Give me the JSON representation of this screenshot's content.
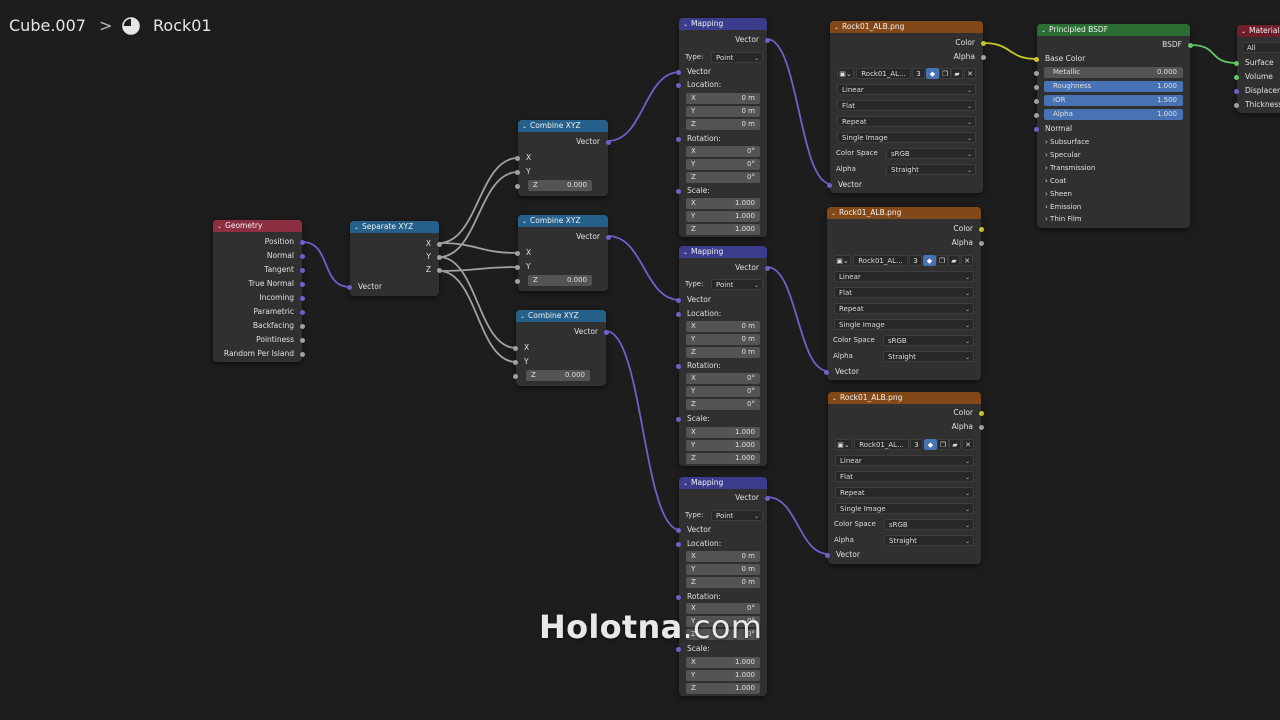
{
  "breadcrumb": {
    "object": "Cube.007",
    "separator": ">",
    "material": "Rock01"
  },
  "geometry": {
    "title": "Geometry",
    "outputs": [
      "Position",
      "Normal",
      "Tangent",
      "True Normal",
      "Incoming",
      "Parametric",
      "Backfacing",
      "Pointiness",
      "Random Per Island"
    ]
  },
  "separate": {
    "title": "Separate XYZ",
    "outputs": [
      "X",
      "Y",
      "Z"
    ],
    "input": "Vector"
  },
  "combine": [
    {
      "title": "Combine XYZ",
      "output": "Vector",
      "x": "X",
      "y": "Y",
      "z_label": "Z",
      "z_value": "0.000"
    },
    {
      "title": "Combine XYZ",
      "output": "Vector",
      "x": "X",
      "y": "Y",
      "z_label": "Z",
      "z_value": "0.000"
    },
    {
      "title": "Combine XYZ",
      "output": "Vector",
      "x": "X",
      "y": "Y",
      "z_label": "Z",
      "z_value": "0.000"
    }
  ],
  "mapping_labels": {
    "title": "Mapping",
    "output": "Vector",
    "type_label": "Type:",
    "type_value": "Point",
    "vector": "Vector",
    "location": "Location:",
    "rotation": "Rotation:",
    "scale": "Scale:",
    "x": "X",
    "y": "Y",
    "z": "Z"
  },
  "mapping": [
    {
      "loc": [
        "0 m",
        "0 m",
        "0 m"
      ],
      "rot": [
        "0°",
        "0°",
        "0°"
      ],
      "scale": [
        "1.000",
        "1.000",
        "1.000"
      ]
    },
    {
      "loc": [
        "0 m",
        "0 m",
        "0 m"
      ],
      "rot": [
        "0°",
        "0°",
        "0°"
      ],
      "scale": [
        "1.000",
        "1.000",
        "1.000"
      ]
    },
    {
      "loc": [
        "0 m",
        "0 m",
        "0 m"
      ],
      "rot": [
        "0°",
        "0°",
        "0°"
      ],
      "scale": [
        "1.000",
        "1.000",
        "1.000"
      ]
    }
  ],
  "texture_labels": {
    "title": "Rock01_ALB.png",
    "color": "Color",
    "alpha": "Alpha",
    "image_name": "Rock01_AL...",
    "users": "3",
    "interpolation": "Linear",
    "projection": "Flat",
    "extension": "Repeat",
    "source": "Single Image",
    "color_space_label": "Color Space",
    "color_space": "sRGB",
    "alpha_label": "Alpha",
    "alpha_mode": "Straight",
    "vector": "Vector"
  },
  "bsdf": {
    "title": "Principled BSDF",
    "output": "BSDF",
    "base_color": "Base Color",
    "metallic_label": "Metallic",
    "metallic": "0.000",
    "roughness_label": "Roughness",
    "roughness": "1.000",
    "ior_label": "IOR",
    "ior": "1.500",
    "alpha_label": "Alpha",
    "alpha": "1.000",
    "normal": "Normal",
    "panels": [
      "Subsurface",
      "Specular",
      "Transmission",
      "Coat",
      "Sheen",
      "Emission",
      "Thin Film"
    ]
  },
  "material_output": {
    "title": "Material",
    "target": "All",
    "inputs": [
      "Surface",
      "Volume",
      "Displacement",
      "Thickness"
    ]
  },
  "watermark": {
    "brand": "Holotna",
    "suffix": ".com"
  },
  "colors": {
    "vector_socket": "#6d62c9",
    "color_socket": "#c7c729",
    "float_socket": "#a1a1a1",
    "shader_socket": "#63c763",
    "geometry_header": "#8e2f41",
    "converter_header": "#24608a",
    "vector_header": "#3c3c8d",
    "texture_header": "#834818",
    "shader_header": "#2a6e33",
    "output_header": "#6e1e2a"
  }
}
